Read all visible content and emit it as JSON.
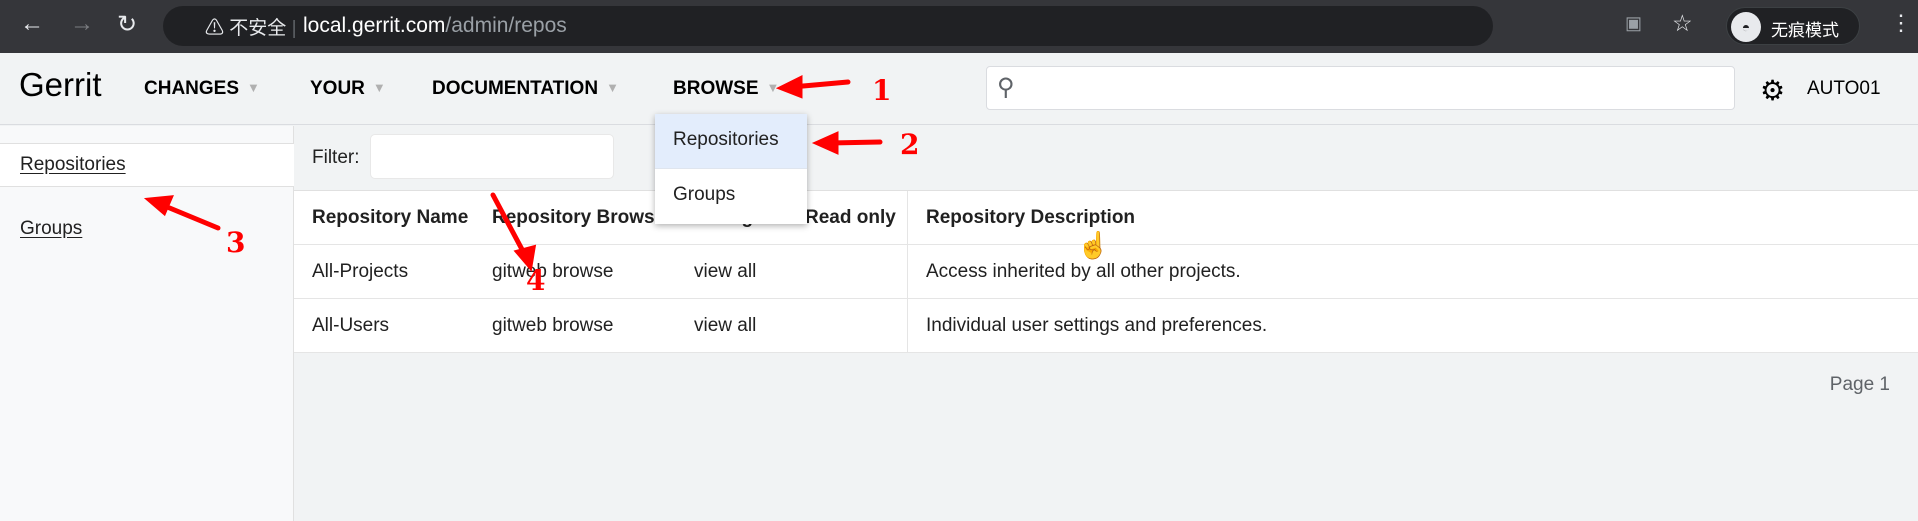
{
  "browser": {
    "insecure_label": "不安全",
    "url_host": "local.gerrit.com",
    "url_path": "/admin/repos",
    "incognito_label": "无痕模式"
  },
  "header": {
    "logo": "Gerrit",
    "nav": [
      "CHANGES",
      "YOUR",
      "DOCUMENTATION",
      "BROWSE"
    ],
    "search_placeholder": "",
    "user": "AUTO01"
  },
  "dropdown": {
    "items": [
      "Repositories",
      "Groups"
    ],
    "selected": "Repositories"
  },
  "sidebar": {
    "items": [
      "Repositories",
      "Groups"
    ]
  },
  "filter": {
    "label": "Filter:",
    "value": ""
  },
  "table": {
    "headers": [
      "Repository Name",
      "Repository Browser",
      "Changes",
      "Read only",
      "Repository Description"
    ],
    "rows": [
      {
        "name": "All-Projects",
        "browser": "gitweb browse",
        "changes": "view all",
        "read_only": "",
        "description": "Access inherited by all other projects."
      },
      {
        "name": "All-Users",
        "browser": "gitweb browse",
        "changes": "view all",
        "read_only": "",
        "description": "Individual user settings and preferences."
      }
    ]
  },
  "pager": "Page 1",
  "annotations": {
    "color": "#ff0000",
    "labels": [
      "1",
      "2",
      "3",
      "4"
    ]
  }
}
